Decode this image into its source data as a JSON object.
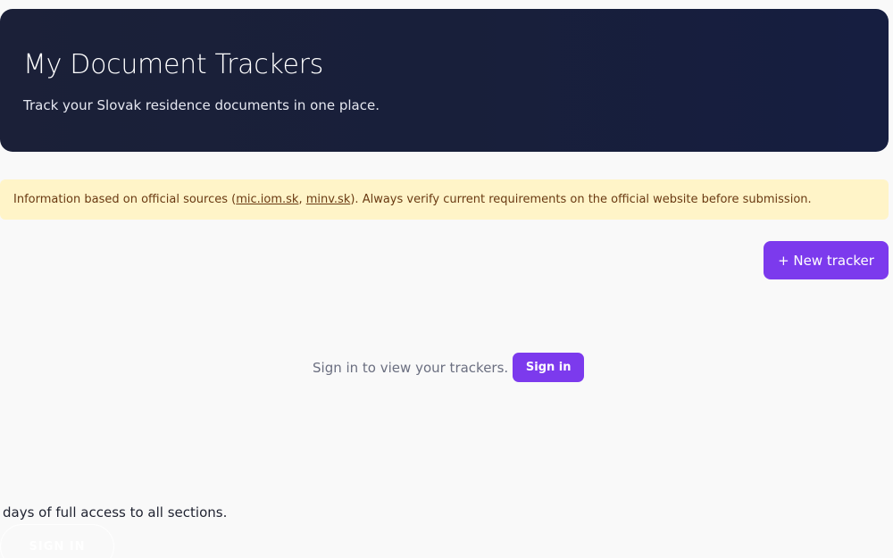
{
  "header": {
    "title": "My Document Trackers",
    "subtitle": "Track your Slovak residence documents in one place."
  },
  "notice": {
    "prefix": "Information based on official sources (",
    "link1": "mic.iom.sk",
    "separator": ", ",
    "link2": "minv.sk",
    "suffix": "). Always verify current requirements on the official website before submission."
  },
  "actions": {
    "new_tracker_label": "+ New tracker"
  },
  "empty_state": {
    "prompt": "Sign in to view your trackers.",
    "sign_in_label": "Sign in"
  },
  "footer_overlay": {
    "trial_text": "days of full access to all sections.",
    "sign_in_label": "SIGN IN"
  },
  "colors": {
    "accent": "#7c3aed",
    "hero_background": "#181f3a",
    "notice_background": "#fff4c8",
    "notice_text": "#6a3a12"
  }
}
